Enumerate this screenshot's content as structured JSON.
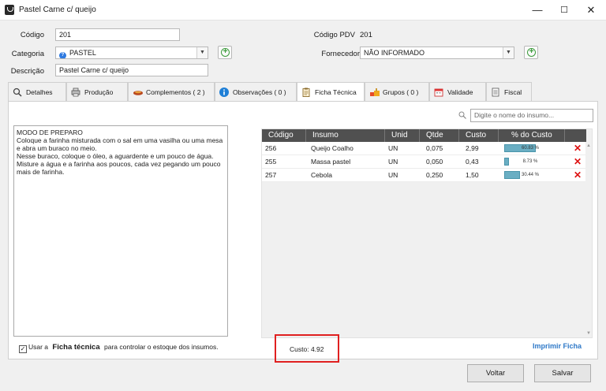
{
  "window": {
    "title": "Pastel Carne c/ queijo",
    "minimize": "—",
    "maximize": "☐",
    "close": "✕"
  },
  "form": {
    "codigo_label": "Código",
    "codigo_value": "201",
    "codigo_pdv_label": "Código PDV",
    "codigo_pdv_value": "201",
    "categoria_label": "Categoria",
    "categoria_value": "PASTEL",
    "categoria_badge": "?",
    "fornecedor_label": "Fornecedor",
    "fornecedor_value": "NÃO INFORMADO",
    "descricao_label": "Descrição",
    "descricao_value": "Pastel Carne c/ queijo"
  },
  "tabs": [
    {
      "label": "Detalhes",
      "icon": "search-icon"
    },
    {
      "label": "Produção",
      "icon": "printer-icon"
    },
    {
      "label": "Complementos ( 2 )",
      "icon": "pastry-icon"
    },
    {
      "label": "Observações ( 0 )",
      "icon": "info-icon"
    },
    {
      "label": "Ficha Técnica",
      "icon": "clipboard-icon"
    },
    {
      "label": "Grupos ( 0 )",
      "icon": "food-icon"
    },
    {
      "label": "Validade",
      "icon": "calendar-icon"
    },
    {
      "label": "Fiscal",
      "icon": "receipt-icon"
    }
  ],
  "ficha": {
    "notes": [
      "MODO DE PREPARO",
      "Coloque a farinha misturada com o sal em uma vasilha ou uma mesa e abra um buraco no meio.",
      "Nesse buraco, coloque o óleo, a aguardente e um pouco de água.",
      "Misture a água e a farinha aos poucos, cada vez pegando um pouco mais de farinha."
    ],
    "search_placeholder": "Digite o nome do insumo...",
    "columns": [
      "Código",
      "Insumo",
      "Unid",
      "Qtde",
      "Custo",
      "% do Custo"
    ],
    "rows": [
      {
        "codigo": "256",
        "insumo": "Queijo Coalho",
        "unid": "UN",
        "qtde": "0,075",
        "custo": "2,99",
        "pct_label": "60.83 %",
        "pct": 60.83
      },
      {
        "codigo": "255",
        "insumo": "Massa pastel",
        "unid": "UN",
        "qtde": "0,050",
        "custo": "0,43",
        "pct_label": "8.73 %",
        "pct": 8.73
      },
      {
        "codigo": "257",
        "insumo": "Cebola",
        "unid": "UN",
        "qtde": "0,250",
        "custo": "1,50",
        "pct_label": "30.44 %",
        "pct": 30.44
      }
    ],
    "use_ficha_checked": true,
    "use_ficha_pre": "Usar a",
    "use_ficha_bold": "Ficha técnica",
    "use_ficha_post": "para controlar o estoque dos insumos.",
    "custo_label": "Custo:",
    "custo_value": "4.92",
    "print_link": "Imprimir Ficha"
  },
  "footer": {
    "voltar": "Voltar",
    "salvar": "Salvar"
  },
  "colors": {
    "accent": "#2f79c8",
    "highlight_border": "#e02020",
    "bar": "#6aaec3",
    "grid_header": "#505050"
  }
}
